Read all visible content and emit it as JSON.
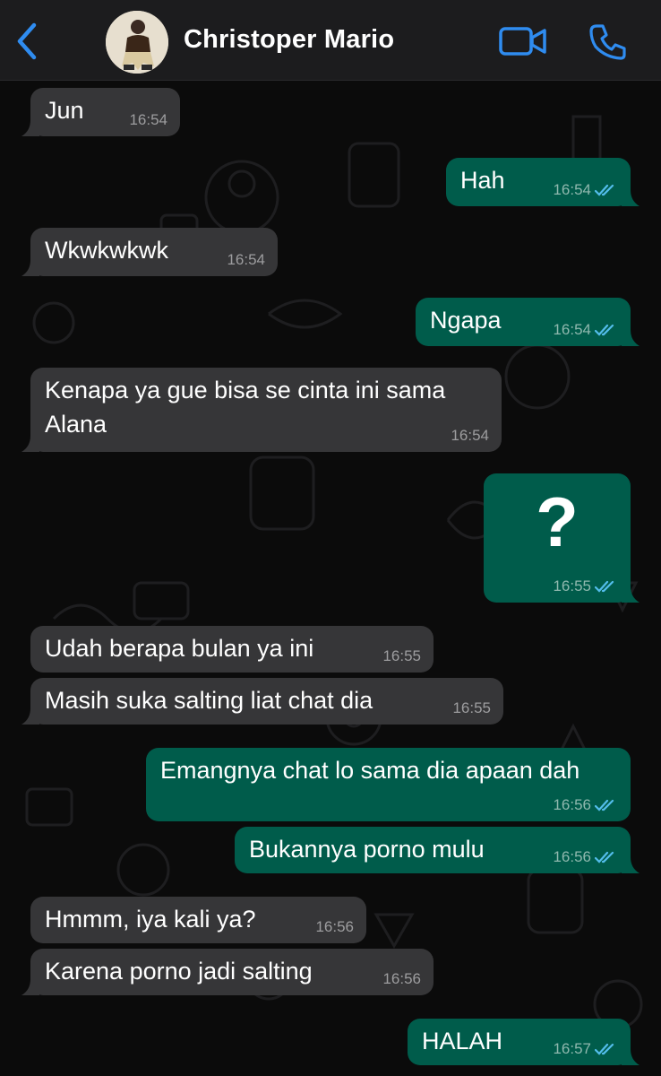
{
  "header": {
    "contact_name": "Christoper Mario",
    "icons": {
      "back": "chevron-left-icon",
      "video": "video-call-icon",
      "call": "phone-icon"
    },
    "accent_color": "#2f8cf0"
  },
  "messages": [
    {
      "dir": "in",
      "text": "Jun",
      "time": "16:54"
    },
    {
      "dir": "out",
      "text": "Hah",
      "time": "16:54",
      "status": "read"
    },
    {
      "dir": "in",
      "text": "Wkwkwkwk",
      "time": "16:54"
    },
    {
      "dir": "out",
      "text": "Ngapa",
      "time": "16:54",
      "status": "read"
    },
    {
      "dir": "in",
      "text_line1": "Kenapa ya gue bisa se cinta ini sama",
      "text_line2": "Alana",
      "time": "16:54"
    },
    {
      "dir": "out",
      "text": "?",
      "time": "16:55",
      "status": "read"
    },
    {
      "dir": "in",
      "text": "Udah berapa bulan ya ini",
      "time": "16:55"
    },
    {
      "dir": "in",
      "text": "Masih suka salting liat chat dia",
      "time": "16:55"
    },
    {
      "dir": "out",
      "text": "Emangnya chat lo sama dia apaan dah",
      "time": "16:56",
      "status": "read"
    },
    {
      "dir": "out",
      "text": "Bukannya porno mulu",
      "time": "16:56",
      "status": "read"
    },
    {
      "dir": "in",
      "text": "Hmmm, iya kali ya?",
      "time": "16:56"
    },
    {
      "dir": "in",
      "text": "Karena porno jadi salting",
      "time": "16:56"
    },
    {
      "dir": "out",
      "text": "HALAH",
      "time": "16:57",
      "status": "read"
    }
  ],
  "colors": {
    "incoming_bubble": "#363638",
    "outgoing_bubble": "#005c4b",
    "read_ticks": "#53bdeb",
    "background": "#0b0b0b"
  }
}
